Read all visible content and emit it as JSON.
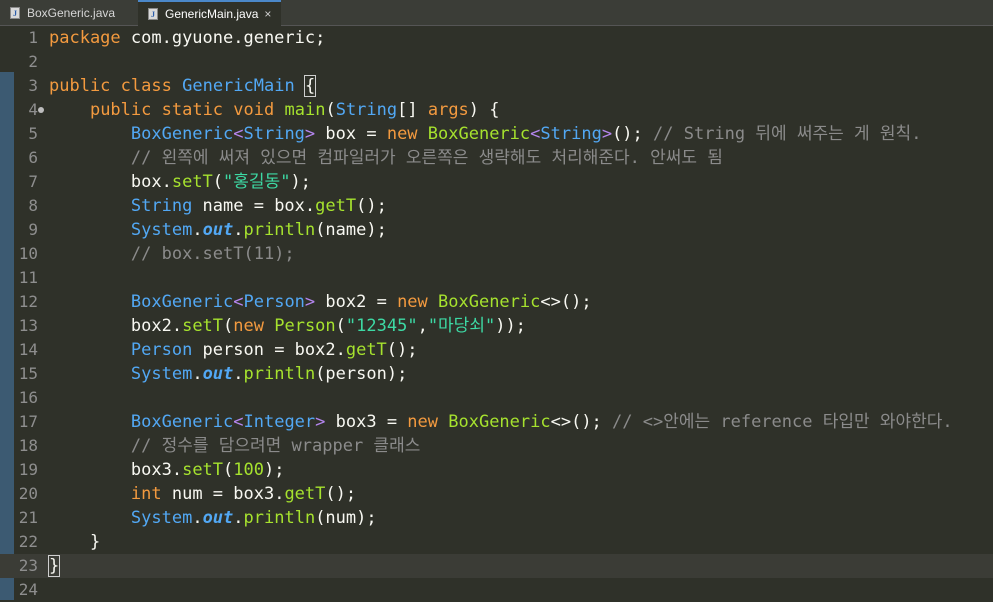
{
  "tabs": [
    {
      "label": "BoxGeneric.java",
      "active": false
    },
    {
      "label": "GenericMain.java",
      "active": true
    }
  ],
  "close_glyph": "×",
  "line_numbers": [
    "1",
    "2",
    "3",
    "4",
    "5",
    "6",
    "7",
    "8",
    "9",
    "10",
    "11",
    "12",
    "13",
    "14",
    "15",
    "16",
    "17",
    "18",
    "19",
    "20",
    "21",
    "22",
    "23",
    "24"
  ],
  "code": {
    "l1": {
      "kw": "package",
      "rest": " com.gyuone.generic;"
    },
    "l3": {
      "kw1": "public",
      "kw2": "class",
      "name": "GenericMain",
      "brace": "{"
    },
    "l4": {
      "kw1": "public",
      "kw2": "static",
      "kw3": "void",
      "m": "main",
      "p1": "(",
      "t": "String",
      "p2": "[] ",
      "arg": "args",
      "p3": ") {"
    },
    "l5": {
      "c1": "BoxGeneric",
      "lt": "<",
      "t": "String",
      "gt": ">",
      "v": " box = ",
      "kw": "new",
      "c2": " BoxGeneric",
      "lt2": "<",
      "t2": "String",
      "gt2": ">",
      "end": "(); ",
      "cm": "// String 뒤에 써주는 게 원칙."
    },
    "l6": {
      "cm": "// 왼쪽에 써져 있으면 컴파일러가 오른쪽은 생략해도 처리해준다. 안써도 됨"
    },
    "l7": {
      "v": "box.",
      "m": "setT",
      "p": "(",
      "s": "\"홍길동\"",
      "e": ");"
    },
    "l8": {
      "t": "String",
      "v": " name = box.",
      "m": "getT",
      "e": "();"
    },
    "l9": {
      "c": "System",
      "d": ".",
      "f": "out",
      "d2": ".",
      "m": "println",
      "e": "(name);"
    },
    "l10": {
      "cm": "// box.setT(11);"
    },
    "l12": {
      "c1": "BoxGeneric",
      "lt": "<",
      "t": "Person",
      "gt": ">",
      "v": " box2 = ",
      "kw": "new",
      "c2": " BoxGeneric",
      "e": "<>();"
    },
    "l13": {
      "v": "box2.",
      "m": "setT",
      "p": "(",
      "kw": "new",
      "c": " Person",
      "p2": "(",
      "s1": "\"12345\"",
      "cma": ",",
      "s2": "\"마당쇠\"",
      "e": "));"
    },
    "l14": {
      "c": "Person",
      "v": " person = box2.",
      "m": "getT",
      "e": "();"
    },
    "l15": {
      "c": "System",
      "d": ".",
      "f": "out",
      "d2": ".",
      "m": "println",
      "e": "(person);"
    },
    "l17": {
      "c1": "BoxGeneric",
      "lt": "<",
      "t": "Integer",
      "gt": ">",
      "v": " box3 = ",
      "kw": "new",
      "c2": " BoxGeneric",
      "e": "<>(); ",
      "cm": "// <>안에는 reference 타입만 와야한다."
    },
    "l18": {
      "cm": "// 정수를 담으려면 wrapper 클래스"
    },
    "l19": {
      "v": "box3.",
      "m": "setT",
      "p": "(",
      "n": "100",
      "e": ");"
    },
    "l20": {
      "kw": "int",
      "v": " num = box3.",
      "m": "getT",
      "e": "();"
    },
    "l21": {
      "c": "System",
      "d": ".",
      "f": "out",
      "d2": ".",
      "m": "println",
      "e": "(num);"
    },
    "l22": {
      "v": "}"
    },
    "l23": {
      "v": "}"
    }
  }
}
